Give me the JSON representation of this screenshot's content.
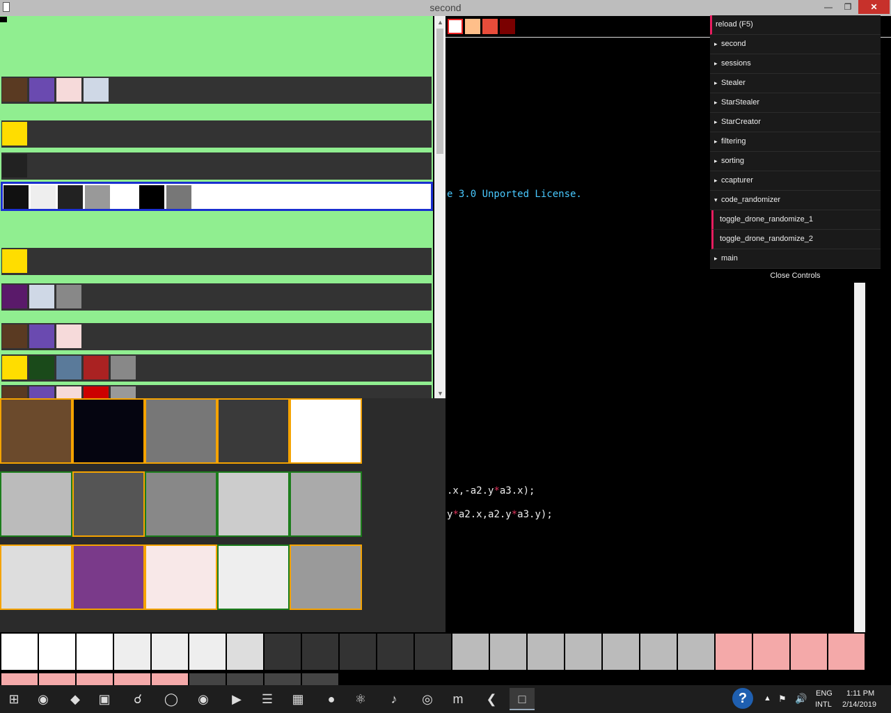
{
  "window": {
    "title": "second"
  },
  "left_rows": [
    {
      "thumbs": [
        "#5a3a22",
        "#6a4ab0",
        "#f6dada",
        "#cfd8e6"
      ]
    },
    {
      "thumbs": [
        "#ffdd00"
      ]
    },
    {
      "thumbs": [
        "#222222"
      ]
    },
    {
      "thumbs": [
        "#111111",
        "#eeeeee",
        "#222222",
        "#999999",
        "#ffffff",
        "#000000",
        "#777777"
      ],
      "selected": true
    },
    {
      "thumbs": [
        "#ffdd00"
      ]
    },
    {
      "thumbs": [
        "#5a1a6a",
        "#cfd8e6",
        "#888888"
      ]
    },
    {
      "thumbs": [
        "#5a3a22",
        "#6a4ab0",
        "#f6dada"
      ]
    },
    {
      "thumbs": [
        "#ffdd00",
        "#1a4a1a",
        "#5a7a9a",
        "#aa2222",
        "#888888"
      ]
    },
    {
      "thumbs": [
        "#5a3a22",
        "#6a4ab0",
        "#f6dada",
        "#cc0000",
        "#999999"
      ]
    }
  ],
  "grid_tiles": [
    {
      "color": "#6b4a2c",
      "border": "orange"
    },
    {
      "color": "#050510",
      "border": "orange"
    },
    {
      "color": "#777777",
      "border": "orange"
    },
    {
      "color": "#3a3a3a",
      "border": "orange"
    },
    {
      "color": "#ffffff",
      "border": "orange"
    },
    {
      "color": "#bbbbbb",
      "border": "green"
    },
    {
      "color": "#555555",
      "border": "orange"
    },
    {
      "color": "#888888",
      "border": "green"
    },
    {
      "color": "#cccccc",
      "border": "green"
    },
    {
      "color": "#aaaaaa",
      "border": "green"
    },
    {
      "color": "#dddddd",
      "border": "orange"
    },
    {
      "color": "#7a3a8a",
      "border": "orange"
    },
    {
      "color": "#f8e8e8",
      "border": "orange"
    },
    {
      "color": "#eeeeee",
      "border": "green"
    },
    {
      "color": "#9a9a9a",
      "border": "orange"
    }
  ],
  "swatches": [
    "#ffffff",
    "#ffbf8a",
    "#e84c3a",
    "#7a0000"
  ],
  "code": {
    "license": "e 3.0 Unported License.",
    "line1_a": ".x,-a2.y",
    "line1_op": "*",
    "line1_b": "a3.x);",
    "line2_a": "y",
    "line2_op": "*",
    "line2_b": "a2.x,a2.y",
    "line2_op2": "*",
    "line2_c": "a3.y);"
  },
  "controls": {
    "reload": "reload (F5)",
    "folders": [
      "second",
      "sessions",
      "Stealer",
      "StarStealer",
      "StarCreator",
      "filtering",
      "sorting",
      "ccapturer"
    ],
    "open_folder": "code_randomizer",
    "sub_buttons": [
      "toggle_drone_randomize_1",
      "toggle_drone_randomize_2"
    ],
    "last_folder": "main",
    "close_label": "Close Controls"
  },
  "taskbar": {
    "lang_top": "ENG",
    "lang_bottom": "INTL",
    "time": "1:11 PM",
    "date": "2/14/2019",
    "icons": [
      "windows-start",
      "chrome",
      "inkscape",
      "sublime",
      "search",
      "firefox",
      "chrome-dev",
      "visual-studio",
      "eclipse",
      "word",
      "node",
      "atom",
      "audio",
      "openframeworks",
      "mumble",
      "vscode",
      "active-window"
    ]
  },
  "strip_colors": [
    "#ffffff",
    "#ffffff",
    "#ffffff",
    "#eeeeee",
    "#eeeeee",
    "#eeeeee",
    "#dddddd",
    "#333333",
    "#333333",
    "#333333",
    "#333333",
    "#333333",
    "#bbbbbb",
    "#bbbbbb",
    "#bbbbbb",
    "#bbbbbb",
    "#bbbbbb",
    "#bbbbbb",
    "#bbbbbb",
    "#f4a9a9",
    "#f4a9a9",
    "#f4a9a9",
    "#f4a9a9"
  ]
}
